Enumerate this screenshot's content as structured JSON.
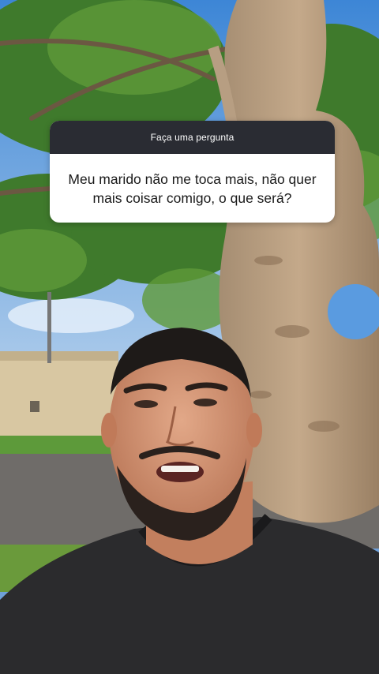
{
  "story": {
    "question_box": {
      "header": "Faça uma pergunta",
      "question": "Meu marido não me toca mais, não quer mais coisar comigo, o que será?"
    }
  },
  "colors": {
    "card_header_bg": "#2a2c33",
    "card_body_bg": "#ffffff",
    "sky": "#6fa0d8"
  }
}
